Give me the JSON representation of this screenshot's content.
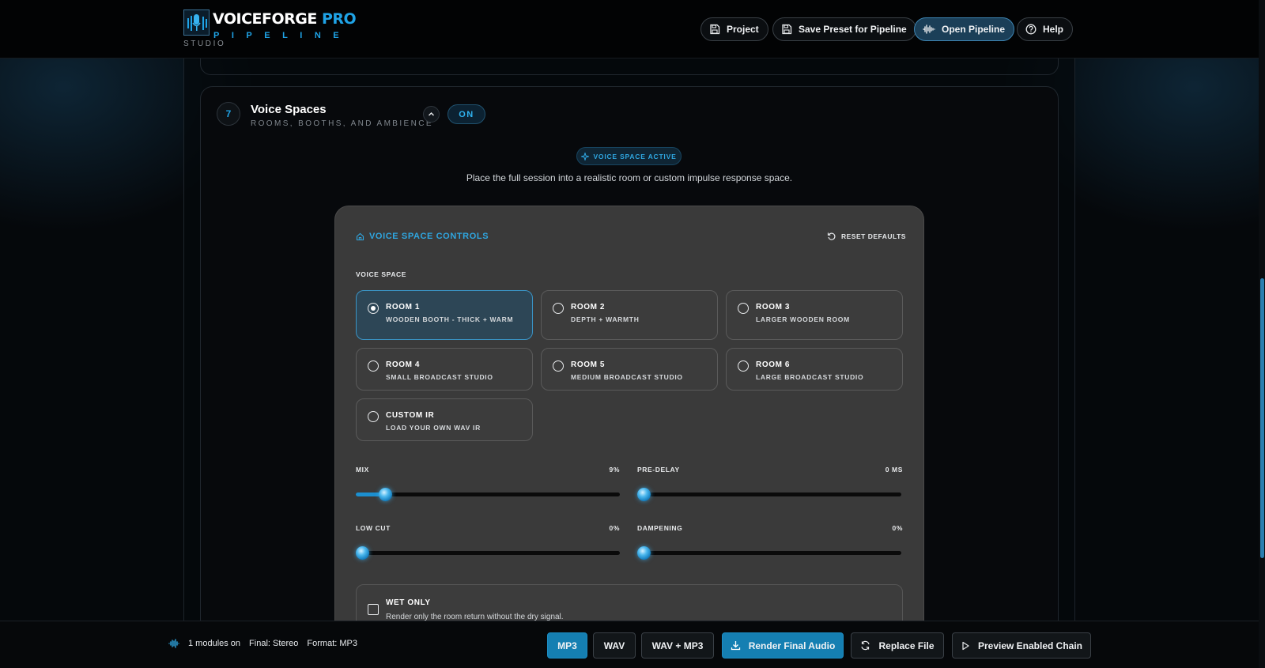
{
  "header": {
    "logo": {
      "title_white": "VOICEFORGE",
      "title_blue": " PRO",
      "subtitle": "PIPELINE",
      "tag": "STUDIO"
    },
    "buttons": [
      {
        "label": "Project",
        "icon": "save-icon"
      },
      {
        "label": "Save Preset for Pipeline",
        "icon": "save-icon"
      },
      {
        "label": "Open Pipeline",
        "icon": "waveform-icon",
        "active": true
      },
      {
        "label": "Help",
        "icon": "help-circle-icon"
      }
    ]
  },
  "section": {
    "number": "7",
    "title": "Voice Spaces",
    "subtitle": "ROOMS, BOOTHS, AND AMBIENCE",
    "toggle_label": "ON",
    "active_badge": "VOICE SPACE ACTIVE",
    "description": "Place the full session into a realistic room or custom impulse response space."
  },
  "controls": {
    "heading": "VOICE SPACE CONTROLS",
    "reset_label": "RESET DEFAULTS",
    "voice_space_label": "VOICE SPACE",
    "rooms": [
      {
        "name": "ROOM 1",
        "desc": "WOODEN BOOTH - THICK + WARM",
        "selected": true
      },
      {
        "name": "ROOM 2",
        "desc": "DEPTH + WARMTH",
        "selected": false
      },
      {
        "name": "ROOM 3",
        "desc": "LARGER WOODEN ROOM",
        "selected": false
      },
      {
        "name": "ROOM 4",
        "desc": "SMALL BROADCAST STUDIO",
        "selected": false
      },
      {
        "name": "ROOM 5",
        "desc": "MEDIUM BROADCAST STUDIO",
        "selected": false
      },
      {
        "name": "ROOM 6",
        "desc": "LARGE BROADCAST STUDIO",
        "selected": false
      },
      {
        "name": "CUSTOM IR",
        "desc": "LOAD YOUR OWN WAV IR",
        "selected": false
      }
    ],
    "sliders": [
      {
        "label": "MIX",
        "value_text": "9%",
        "fraction": 0.11
      },
      {
        "label": "PRE-DELAY",
        "value_text": "0 MS",
        "fraction": 0
      },
      {
        "label": "LOW CUT",
        "value_text": "0%",
        "fraction": 0
      },
      {
        "label": "DAMPENING",
        "value_text": "0%",
        "fraction": 0
      }
    ],
    "wet_only": {
      "title": "WET ONLY",
      "description": "Render only the room return without the dry signal.",
      "checked": false
    }
  },
  "footer": {
    "status": {
      "modules": "1 modules on",
      "final": "Final: Stereo",
      "format": "Format: MP3"
    },
    "buttons": [
      {
        "label": "MP3",
        "selected": true
      },
      {
        "label": "WAV"
      },
      {
        "label": "WAV + MP3"
      },
      {
        "label": "Render Final Audio",
        "icon": "download-icon",
        "primary": true
      },
      {
        "label": "Replace File",
        "icon": "refresh-icon"
      },
      {
        "label": "Preview Enabled Chain",
        "icon": "play-icon"
      }
    ]
  },
  "colors": {
    "accent": "#1fa3e6",
    "panel": "#3a3a3a",
    "selected_room": "#2d4656"
  }
}
